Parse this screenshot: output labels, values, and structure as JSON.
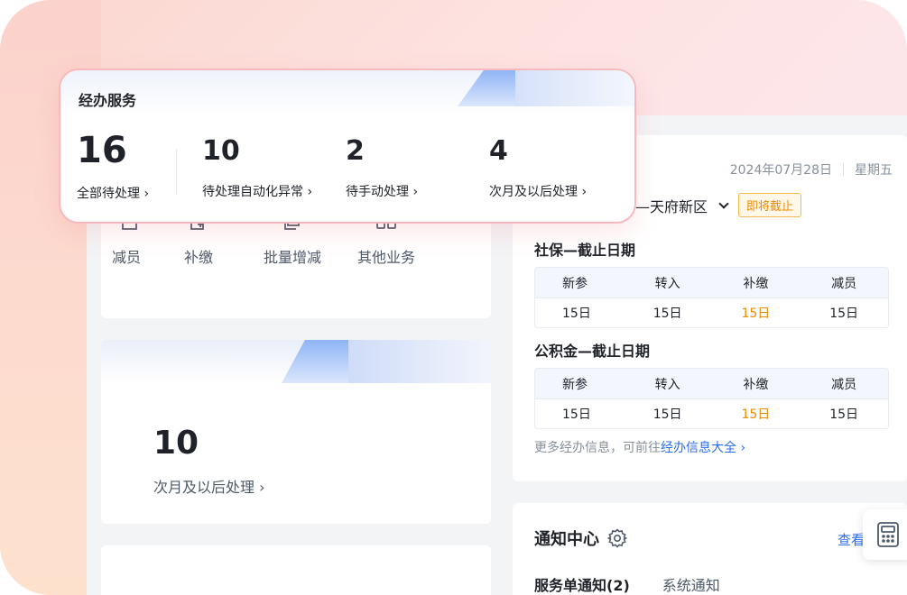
{
  "popup": {
    "title": "经办服务",
    "items": [
      {
        "value": "16",
        "label": "全部待处理 ›"
      },
      {
        "value": "10",
        "label": "待处理自动化异常 ›"
      },
      {
        "value": "2",
        "label": "待手动处理 ›"
      },
      {
        "value": "4",
        "label": "次月及以后处理 ›"
      }
    ]
  },
  "quick_actions": [
    {
      "label": "减员",
      "icon": "remove-member-icon"
    },
    {
      "label": "补缴",
      "icon": "supplement-payment-icon"
    },
    {
      "label": "批量增减",
      "icon": "batch-document-icon"
    },
    {
      "label": "其他业务",
      "icon": "grid-apps-icon"
    }
  ],
  "stat_card": {
    "value": "10",
    "label": "次月及以后处理 ›"
  },
  "deadline": {
    "date": "2024年07月28日",
    "weekday": "星期五",
    "region": "—天府新区",
    "badge": "即将截止",
    "social": {
      "title": "社保—截止日期",
      "headers": [
        "新参",
        "转入",
        "补缴",
        "减员"
      ],
      "values": [
        "15日",
        "15日",
        "15日",
        "15日"
      ]
    },
    "fund": {
      "title": "公积金—截止日期",
      "headers": [
        "新参",
        "转入",
        "补缴",
        "减员"
      ],
      "values": [
        "15日",
        "15日",
        "15日",
        "15日"
      ]
    },
    "more_prefix": "更多经办信息，可前往",
    "more_link": "经办信息大全 ›"
  },
  "notice": {
    "title": "通知中心",
    "more": "查看",
    "tabs": [
      "服务单通知(2)",
      "系统通知"
    ]
  },
  "colors": {
    "accent_blue": "#2a6ef0",
    "warning_orange": "#f08a00",
    "popup_border": "#f7b9bd"
  }
}
